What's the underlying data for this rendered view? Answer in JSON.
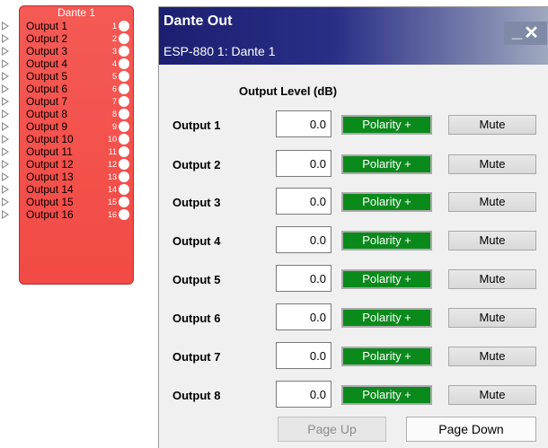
{
  "block": {
    "title": "Dante 1",
    "outputs": [
      {
        "label": "Output 1",
        "num": "1"
      },
      {
        "label": "Output 2",
        "num": "2"
      },
      {
        "label": "Output 3",
        "num": "3"
      },
      {
        "label": "Output 4",
        "num": "4"
      },
      {
        "label": "Output 5",
        "num": "5"
      },
      {
        "label": "Output 6",
        "num": "6"
      },
      {
        "label": "Output 7",
        "num": "7"
      },
      {
        "label": "Output 8",
        "num": "8"
      },
      {
        "label": "Output 9",
        "num": "9"
      },
      {
        "label": "Output 10",
        "num": "10"
      },
      {
        "label": "Output 11",
        "num": "11"
      },
      {
        "label": "Output 12",
        "num": "12"
      },
      {
        "label": "Output 13",
        "num": "13"
      },
      {
        "label": "Output 14",
        "num": "14"
      },
      {
        "label": "Output 15",
        "num": "15"
      },
      {
        "label": "Output 16",
        "num": "16"
      }
    ],
    "color": "#f24a45"
  },
  "dialog": {
    "title": "Dante Out",
    "subtitle": "ESP-880 1: Dante 1",
    "minimize": "_",
    "close": "✕",
    "column_header": "Output Level (dB)",
    "channels": [
      {
        "label": "Output 1",
        "level": "0.0",
        "polarity": "Polarity +",
        "mute": "Mute"
      },
      {
        "label": "Output 2",
        "level": "0.0",
        "polarity": "Polarity +",
        "mute": "Mute"
      },
      {
        "label": "Output 3",
        "level": "0.0",
        "polarity": "Polarity +",
        "mute": "Mute"
      },
      {
        "label": "Output 4",
        "level": "0.0",
        "polarity": "Polarity +",
        "mute": "Mute"
      },
      {
        "label": "Output 5",
        "level": "0.0",
        "polarity": "Polarity +",
        "mute": "Mute"
      },
      {
        "label": "Output 6",
        "level": "0.0",
        "polarity": "Polarity +",
        "mute": "Mute"
      },
      {
        "label": "Output 7",
        "level": "0.0",
        "polarity": "Polarity +",
        "mute": "Mute"
      },
      {
        "label": "Output 8",
        "level": "0.0",
        "polarity": "Polarity +",
        "mute": "Mute"
      }
    ],
    "page_up": "Page Up",
    "page_down": "Page Down",
    "polarity_color": "#0b8a1c",
    "titlebar_color": "#1c1f70"
  }
}
